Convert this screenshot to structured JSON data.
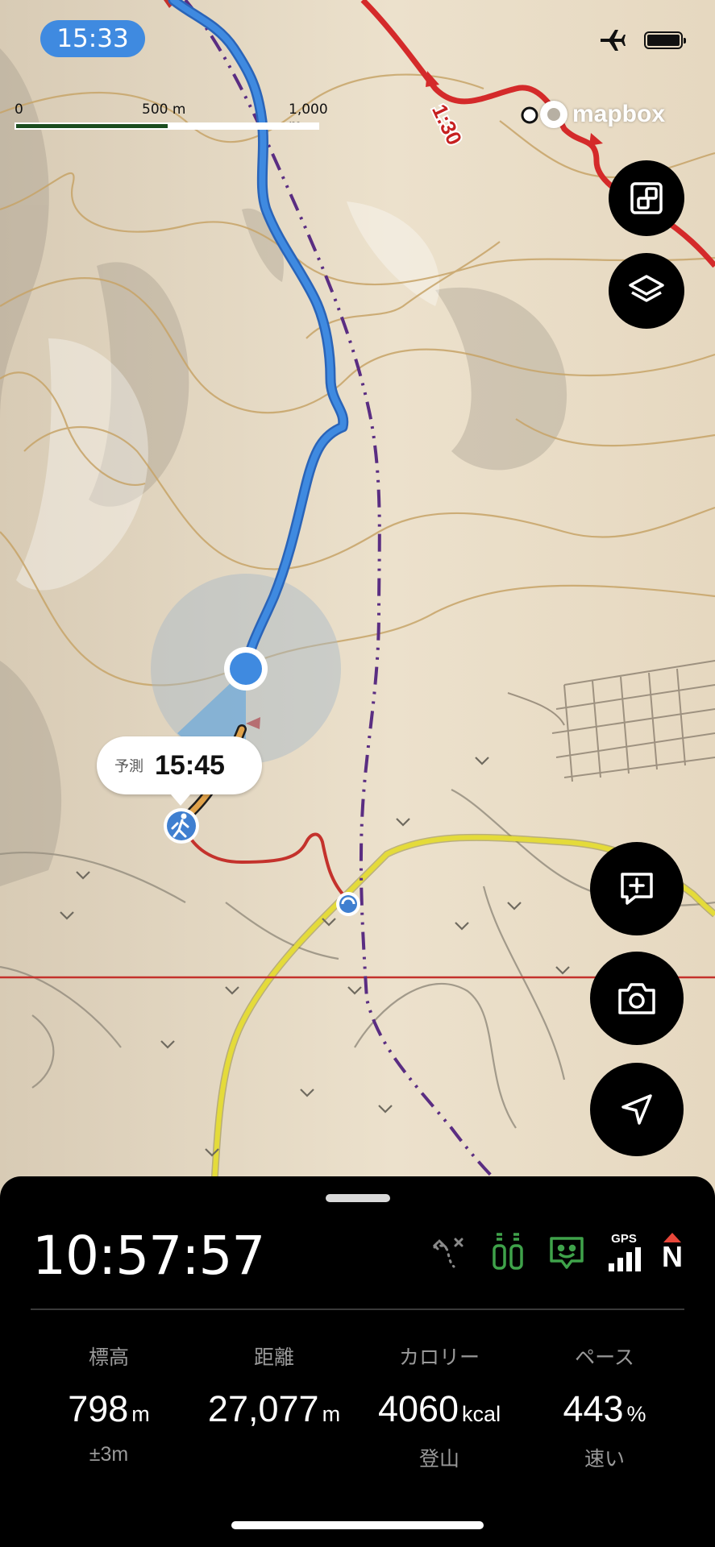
{
  "status_bar": {
    "time": "15:33",
    "airplane_icon": "airplane-icon",
    "battery_icon": "battery-icon",
    "battery_level": 0.9
  },
  "map": {
    "scale": {
      "label_0": "0",
      "label_500": "500 m",
      "label_1000": "1,000 m"
    },
    "attribution": "mapbox",
    "trail_label": "1:30",
    "colors": {
      "route": "#3f8ae0",
      "trail_red": "#d42a2a",
      "road_yellow": "#e4db3a",
      "boundary": "#5a2d82",
      "contour": "#c7a468",
      "terrain": "#e9dcc6"
    },
    "buttons": {
      "fit": "fit-screen-icon",
      "layers": "layers-icon",
      "add_note": "add-note-icon",
      "camera": "camera-icon",
      "locate": "navigation-arrow-icon"
    },
    "prediction": {
      "label": "予測",
      "time": "15:45"
    },
    "markers": {
      "hiker": "hiker-icon",
      "junction": "trail-junction-icon"
    }
  },
  "panel": {
    "clock": "10:57:57",
    "icons": [
      "route-icon",
      "bottles-icon",
      "companion-icon",
      "gps-signal-icon",
      "compass-north-icon"
    ],
    "gps_label": "GPS",
    "north_label": "N",
    "stats": [
      {
        "heading": "標高",
        "value": "798",
        "unit": "m",
        "sub": "±3m"
      },
      {
        "heading": "距離",
        "value": "27,077",
        "unit": "m",
        "sub": ""
      },
      {
        "heading": "カロリー",
        "value": "4060",
        "unit": "kcal",
        "sub": "登山"
      },
      {
        "heading": "ペース",
        "value": "443",
        "unit": "%",
        "sub": "速い"
      }
    ]
  }
}
